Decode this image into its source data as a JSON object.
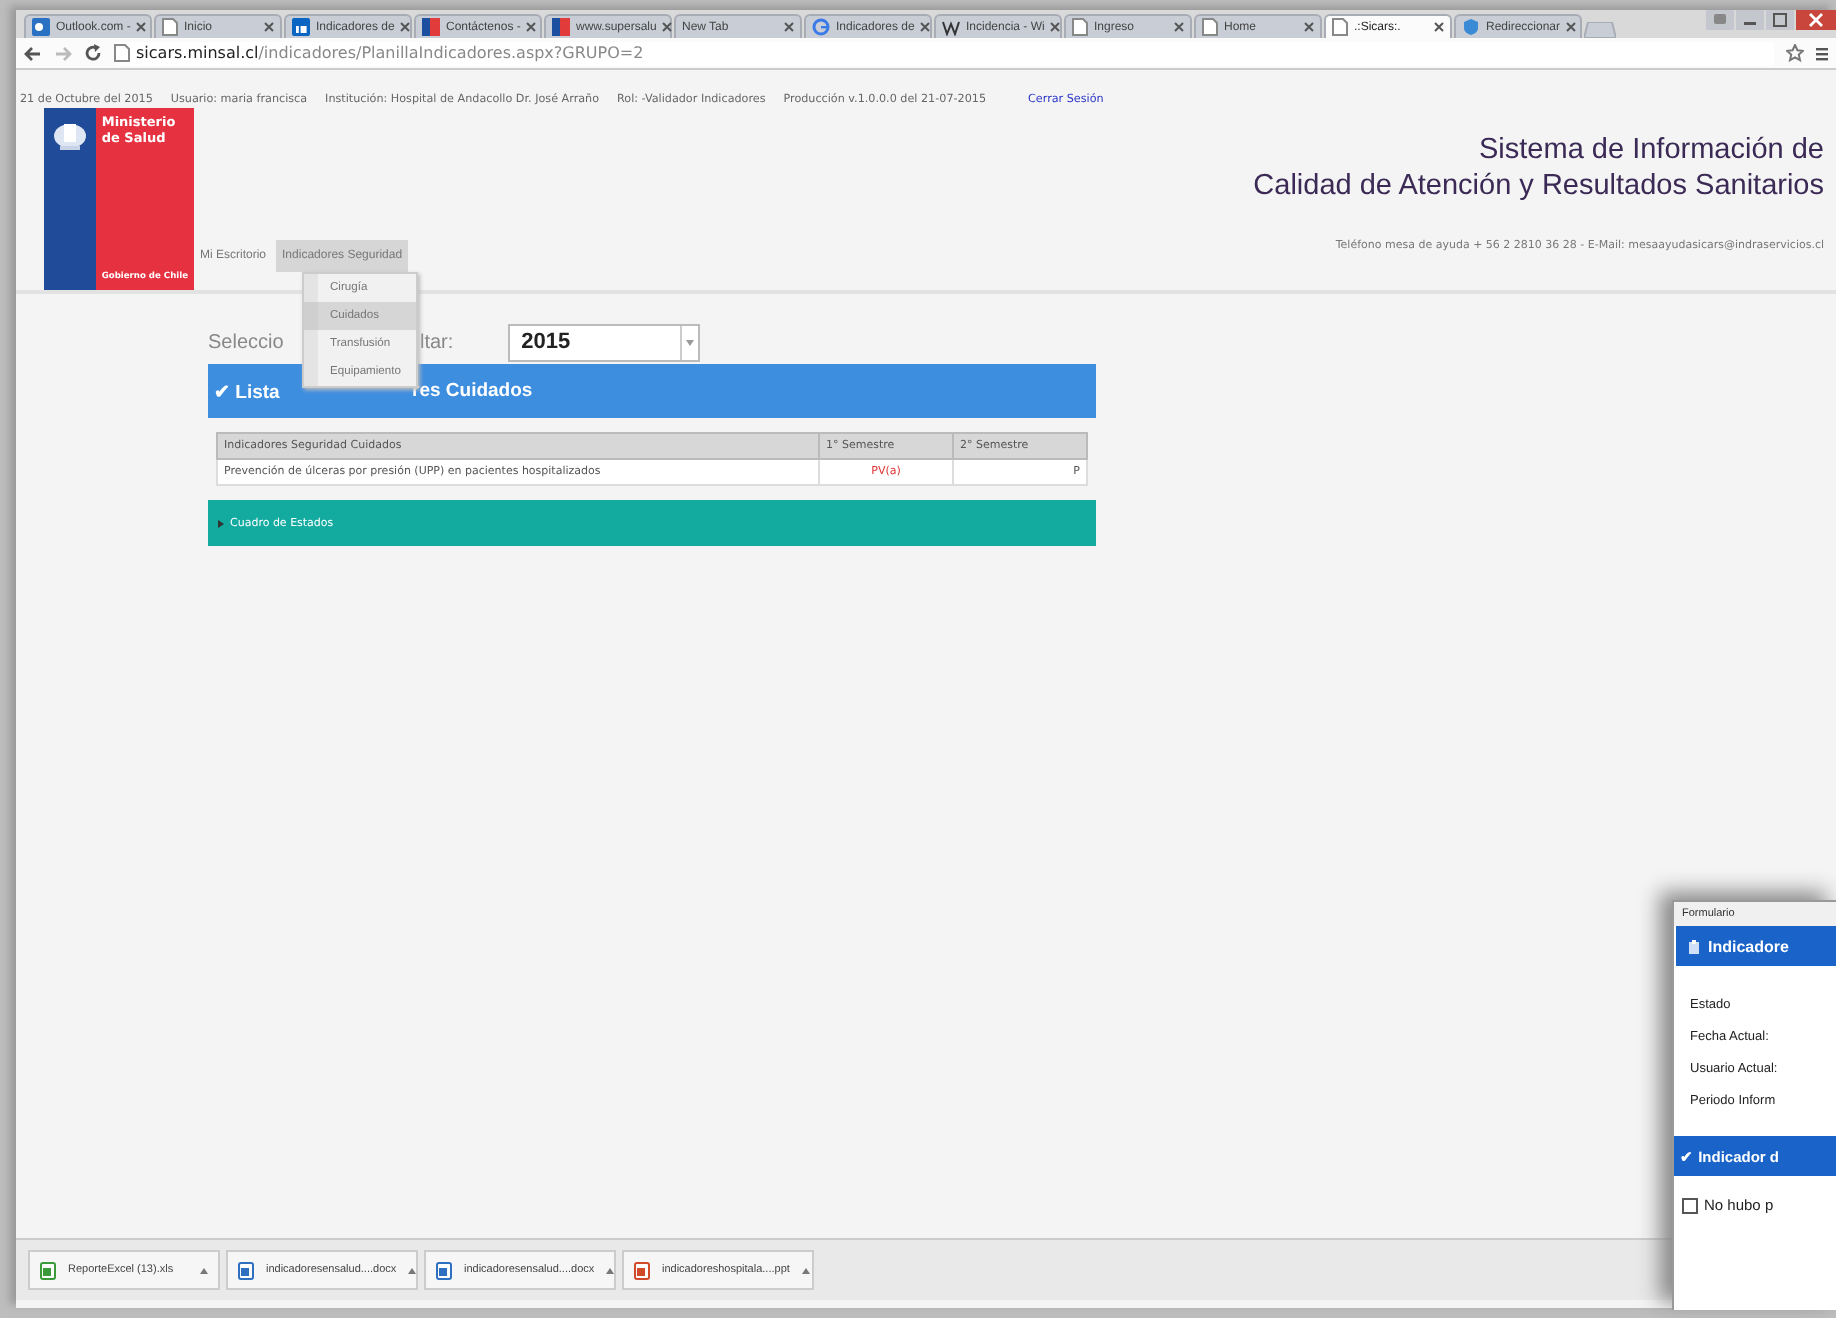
{
  "browser": {
    "tabs": [
      {
        "title": "Outlook.com -",
        "kind": "outlook",
        "selected": false
      },
      {
        "title": "Inicio",
        "kind": "page",
        "selected": false
      },
      {
        "title": "Indicadores de",
        "kind": "linkedin",
        "selected": false
      },
      {
        "title": "Contáctenos -",
        "kind": "flag",
        "selected": false
      },
      {
        "title": "www.supersalu",
        "kind": "flag",
        "selected": false
      },
      {
        "title": "New Tab",
        "kind": "none",
        "selected": false
      },
      {
        "title": "Indicadores de",
        "kind": "google",
        "selected": false
      },
      {
        "title": "Incidencia - Wi",
        "kind": "wiki",
        "selected": false
      },
      {
        "title": "Ingreso",
        "kind": "page",
        "selected": false
      },
      {
        "title": "Home",
        "kind": "page",
        "selected": false
      },
      {
        "title": ".:Sicars:.",
        "kind": "page",
        "selected": true
      },
      {
        "title": "Redireccionar",
        "kind": "shield",
        "selected": false
      }
    ],
    "url_host": "sicars.minsal.cl",
    "url_path": "/indicadores/PlanillaIndicadores.aspx?GRUPO=2"
  },
  "session": {
    "items": [
      "21 de Octubre del 2015",
      "Usuario: maria francisca",
      "Institución: Hospital de Andacollo Dr. José Arraño",
      "Rol: -Validador Indicadores",
      "Producción v.1.0.0.0 del 21-07-2015"
    ],
    "logout": "Cerrar Sesión"
  },
  "logo": {
    "ministry": "Ministerio de Salud",
    "government": "Gobierno de Chile"
  },
  "header": {
    "title_lines": [
      "Sistema de Información de",
      "Calidad de Atención y Resultados Sanitarios"
    ],
    "help": "Teléfono mesa de ayuda + 56 2 2810 36 28 - E-Mail: mesaayudasicars@indraservicios.cl"
  },
  "nav": {
    "tabs": [
      {
        "label": "Mi Escritorio",
        "selected": false
      },
      {
        "label": "Indicadores Seguridad",
        "selected": true
      }
    ],
    "menu": [
      {
        "label": "Cirugía",
        "selected": false
      },
      {
        "label": "Cuidados",
        "selected": true
      },
      {
        "label": "Transfusión",
        "selected": false
      },
      {
        "label": "Equipamiento",
        "selected": false
      }
    ]
  },
  "year_picker": {
    "label_parts": [
      "Seleccio",
      "ltar:"
    ],
    "value": "2015"
  },
  "list_panel": {
    "check": "✔",
    "title_parts": [
      "Lista",
      "res Cuidados"
    ],
    "table": {
      "columns": [
        "Indicadores Seguridad Cuidados",
        "1° Semestre",
        "2° Semestre"
      ],
      "rows": [
        {
          "cells": [
            "Prevención de úlceras por presión (UPP) en pacientes hospitalizados",
            "PV(a)",
            "P"
          ]
        }
      ]
    }
  },
  "status_panel": {
    "title": "Cuadro de Estados"
  },
  "downloads": [
    {
      "name": "ReporteExcel (13).xls",
      "kind": "excel"
    },
    {
      "name": "indicadoresensalud....docx",
      "kind": "word"
    },
    {
      "name": "indicadoresensalud....docx",
      "kind": "word"
    },
    {
      "name": "indicadoreshospitala....ppt",
      "kind": "powerpoint"
    }
  ],
  "form_window": {
    "title": "Formulario",
    "header": "Indicadore",
    "fields": [
      "Estado",
      "Fecha Actual:",
      "Usuario Actual:",
      "Periodo Inform"
    ],
    "check": "✔",
    "section": "Indicador d",
    "checkbox": {
      "label": "No hubo p",
      "checked": false
    }
  }
}
